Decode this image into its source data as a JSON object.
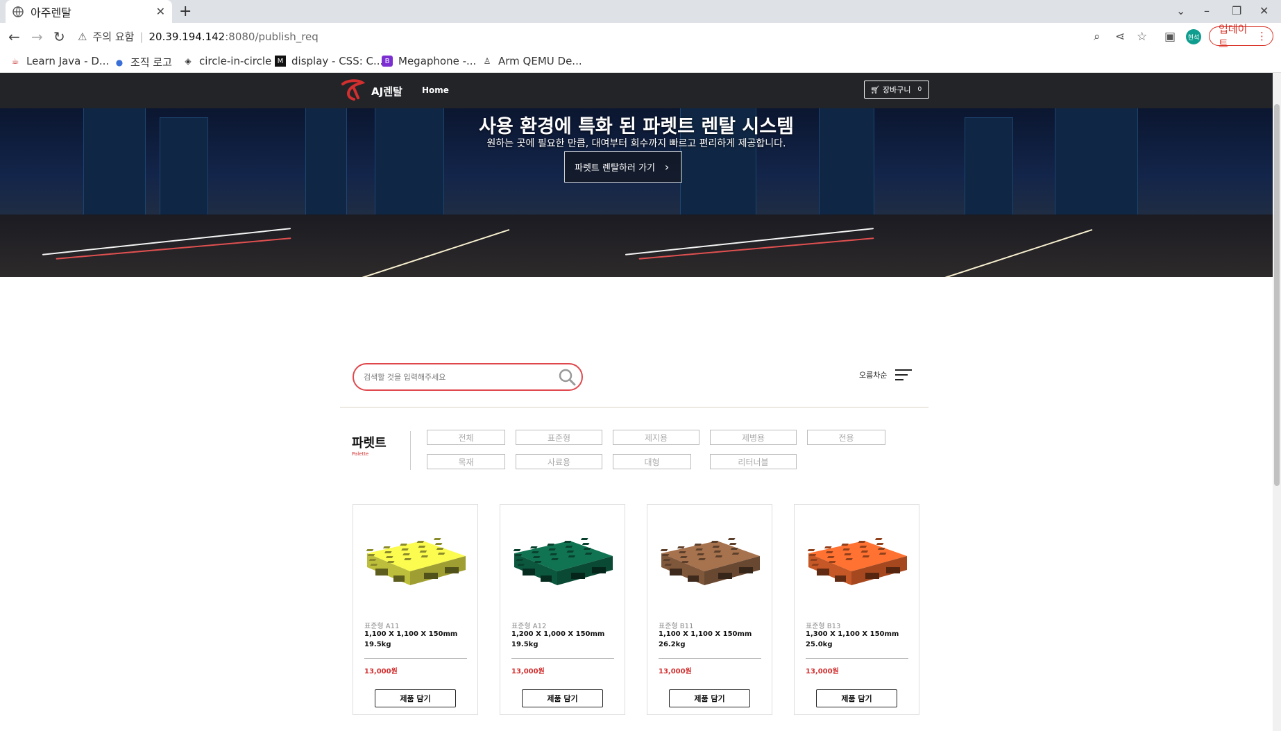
{
  "browser": {
    "tab_title": "아주렌탈",
    "new_tab": "+",
    "address": {
      "security_label": "주의 요함",
      "host": "20.39.194.142",
      "path": ":8080/publish_req"
    },
    "update_label": "업데이트",
    "profile_initial": "현석",
    "bookmarks": [
      {
        "label": "Learn Java - D..."
      },
      {
        "label": "조직 로고"
      },
      {
        "label": "circle-in-circle"
      },
      {
        "label": "display - CSS: C..."
      },
      {
        "label": "Megaphone -..."
      },
      {
        "label": "Arm QEMU De..."
      }
    ]
  },
  "site": {
    "brand": "AJ렌탈",
    "nav_home": "Home",
    "cart_label": "장바구니",
    "cart_count": "0",
    "brand_color": "#d32f2f"
  },
  "hero": {
    "title": "사용 환경에 특화 된 파렛트 렌탈 시스템",
    "subtitle": "원하는 곳에 필요한 만큼, 대여부터 회수까지 빠르고 편리하게 제공합니다.",
    "cta": "파렛트 렌탈하러 가기"
  },
  "search": {
    "placeholder": "검색할 것을 입력해주세요",
    "sort_label": "오름차순"
  },
  "category": {
    "title": "파렛트",
    "subtitle": "Palette",
    "chips_row1": [
      "전체",
      "표준형",
      "제지용",
      "제병용",
      "전용"
    ],
    "chips_row2": [
      "목재",
      "사료용",
      "대형",
      "리터너블"
    ]
  },
  "products": [
    {
      "type": "표준형 A11",
      "dims": "1,100 X 1,100 X 150mm",
      "weight": "19.5kg",
      "price": "13,000원",
      "button": "제품 담기",
      "color": "#e8e84a"
    },
    {
      "type": "표준형 A12",
      "dims": "1,200 X 1,000 X 150mm",
      "weight": "19.5kg",
      "price": "13,000원",
      "button": "제품 담기",
      "color": "#0f6b4d"
    },
    {
      "type": "표준형 B11",
      "dims": "1,100 X 1,100 X 150mm",
      "weight": "26.2kg",
      "price": "13,000원",
      "button": "제품 담기",
      "color": "#9b6a48"
    },
    {
      "type": "표준형 B13",
      "dims": "1,300 X 1,100 X 150mm",
      "weight": "25.0kg",
      "price": "13,000원",
      "button": "제품 담기",
      "color": "#f26a2e"
    }
  ]
}
